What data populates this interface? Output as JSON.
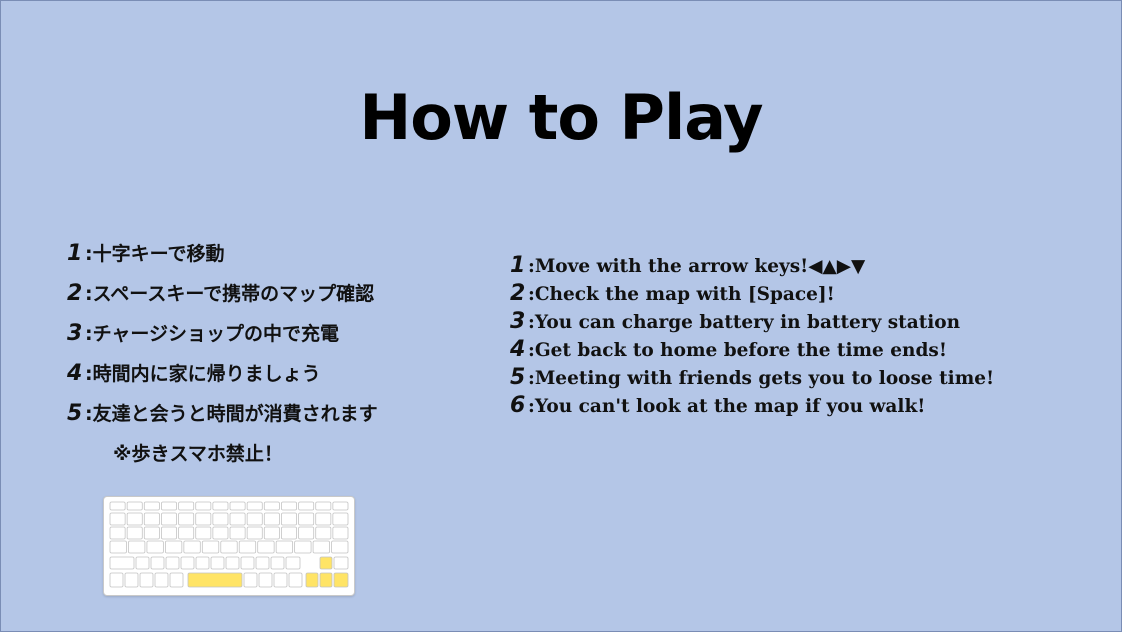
{
  "title": "How to Play",
  "jp_instructions": [
    {
      "num": "1",
      "text": ":十字キーで移動"
    },
    {
      "num": "2",
      "text": ":スペースキーで携帯のマップ確認"
    },
    {
      "num": "3",
      "text": ":チャージショップの中で充電"
    },
    {
      "num": "4",
      "text": ":時間内に家に帰りましょう"
    },
    {
      "num": "5",
      "text": ":友達と会うと時間が消費されます"
    }
  ],
  "jp_note": "※歩きスマホ禁止！",
  "en_instructions": [
    {
      "num": "1",
      "text": ":Move with the arrow keys!◀▲▶▼"
    },
    {
      "num": "2",
      "text": ":Check the map with [Space]!"
    },
    {
      "num": "3",
      "text": ":You can charge battery in battery station"
    },
    {
      "num": "4",
      "text": ":Get back to home before the time ends!"
    },
    {
      "num": "5",
      "text": ":Meeting with friends gets you to loose time!"
    },
    {
      "num": "6",
      "text": ":You can't look at the map if you walk!"
    }
  ],
  "keyboard": {
    "highlight_color": "#ffe466",
    "highlighted_keys": [
      "space-key",
      "arrow-up-key",
      "arrow-left-key",
      "arrow-down-key",
      "arrow-right-key"
    ]
  },
  "colors": {
    "background": "#b4c6e7",
    "text": "#111111"
  }
}
